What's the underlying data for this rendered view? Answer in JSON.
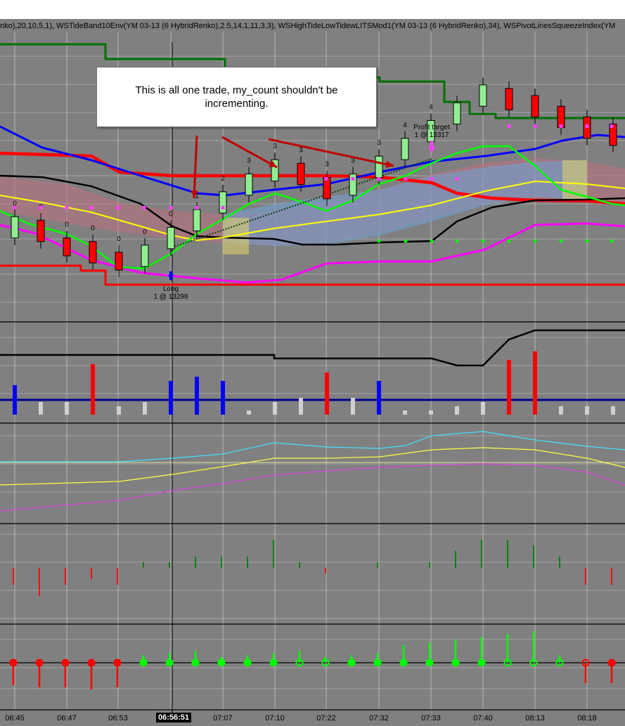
{
  "indicator_title": "nko),20,10,5,1), WSTideBand10Env(YM 03-13 (6 HybridRenko),2.5,14,1,11,3,3), WSHighTideLowTidewLITSMod1(YM 03-13 (6 HybridRenko),34), WSPivotLinesSqueezeIndex(YM",
  "annotation": "This is all one trade, my_count shouldn't be incrementing.",
  "entry": {
    "name": "Long",
    "detail": "1 @ 13298"
  },
  "exit": {
    "name": "Profit target",
    "detail": "1 @ 13317"
  },
  "cursor_time": "06:56:51",
  "time_labels": [
    "06:45",
    "06:47",
    "06:53",
    "07:07",
    "07:10",
    "07:22",
    "07:32",
    "07:33",
    "07:40",
    "08:13",
    "08:18"
  ],
  "colors": {
    "background": "#808080",
    "up_bar": "#90ee90",
    "down_bar": "#ff0000",
    "grid": "#ffffff"
  },
  "bar_counts": [
    "0",
    "0",
    "0",
    "0",
    "0",
    "0",
    "0",
    "1",
    "2",
    "3",
    "3",
    "3",
    "3",
    "3",
    "3",
    "4",
    "4"
  ],
  "chart_data": {
    "type": "candlestick",
    "bars": [
      {
        "dir": "up",
        "open": 13290,
        "close": 13296
      },
      {
        "dir": "down",
        "open": 13295,
        "close": 13289
      },
      {
        "dir": "down",
        "open": 13290,
        "close": 13285
      },
      {
        "dir": "down",
        "open": 13289,
        "close": 13283
      },
      {
        "dir": "down",
        "open": 13286,
        "close": 13281
      },
      {
        "dir": "up",
        "open": 13282,
        "close": 13288
      },
      {
        "dir": "up",
        "open": 13287,
        "close": 13293
      },
      {
        "dir": "up",
        "open": 13292,
        "close": 13298
      },
      {
        "dir": "up",
        "open": 13297,
        "close": 13303
      },
      {
        "dir": "up",
        "open": 13302,
        "close": 13308
      },
      {
        "dir": "up",
        "open": 13306,
        "close": 13312
      },
      {
        "dir": "down",
        "open": 13311,
        "close": 13305
      },
      {
        "dir": "down",
        "open": 13307,
        "close": 13301
      },
      {
        "dir": "up",
        "open": 13302,
        "close": 13308
      },
      {
        "dir": "up",
        "open": 13307,
        "close": 13313
      },
      {
        "dir": "up",
        "open": 13312,
        "close": 13318
      },
      {
        "dir": "up",
        "open": 13317,
        "close": 13323
      },
      {
        "dir": "up",
        "open": 13322,
        "close": 13328
      },
      {
        "dir": "up",
        "open": 13327,
        "close": 13333
      },
      {
        "dir": "down",
        "open": 13332,
        "close": 13326
      },
      {
        "dir": "down",
        "open": 13330,
        "close": 13324
      },
      {
        "dir": "down",
        "open": 13327,
        "close": 13321
      },
      {
        "dir": "down",
        "open": 13324,
        "close": 13318
      },
      {
        "dir": "down",
        "open": 13322,
        "close": 13316
      }
    ],
    "volume": [
      {
        "color": "blue",
        "value": 7
      },
      {
        "color": "gray",
        "value": 3
      },
      {
        "color": "gray",
        "value": 3
      },
      {
        "color": "red",
        "value": 12
      },
      {
        "color": "gray",
        "value": 2
      },
      {
        "color": "gray",
        "value": 3
      },
      {
        "color": "blue",
        "value": 8
      },
      {
        "color": "blue",
        "value": 9
      },
      {
        "color": "blue",
        "value": 8
      },
      {
        "color": "gray",
        "value": 1
      },
      {
        "color": "gray",
        "value": 3
      },
      {
        "color": "gray",
        "value": 4
      },
      {
        "color": "red",
        "value": 10
      },
      {
        "color": "gray",
        "value": 4
      },
      {
        "color": "blue",
        "value": 8
      },
      {
        "color": "gray",
        "value": 1
      },
      {
        "color": "gray",
        "value": 1
      },
      {
        "color": "gray",
        "value": 2
      },
      {
        "color": "gray",
        "value": 3
      },
      {
        "color": "red",
        "value": 13
      },
      {
        "color": "red",
        "value": 15
      },
      {
        "color": "gray",
        "value": 2
      },
      {
        "color": "gray",
        "value": 2
      },
      {
        "color": "gray",
        "value": 2
      }
    ],
    "histogram": [
      -3,
      -5,
      -3,
      -2,
      -3,
      1,
      1,
      2,
      2,
      2,
      5,
      1,
      -1,
      0,
      1,
      0,
      1,
      3,
      5,
      5,
      4,
      2,
      -3,
      -3,
      -2
    ],
    "oscillator": [
      -4,
      -5,
      -5,
      -6,
      -5,
      -5,
      -4,
      -3,
      -3,
      -3,
      -3,
      -2,
      -2,
      -2,
      -2,
      -2,
      -2,
      -2,
      -3,
      -4,
      -5,
      -5,
      -3,
      -3,
      -2
    ]
  }
}
